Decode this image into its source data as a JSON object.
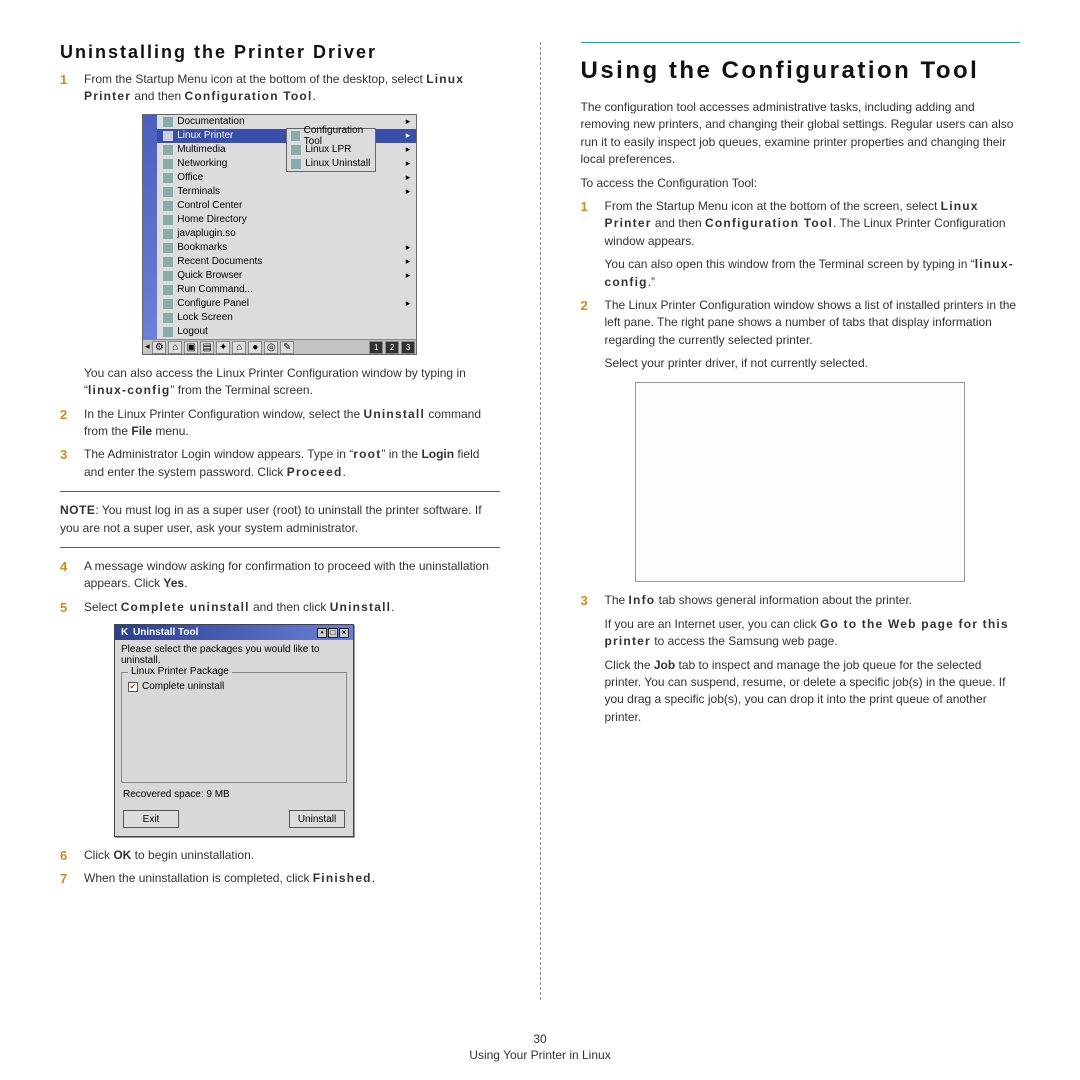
{
  "left": {
    "heading": "Uninstalling the Printer Driver",
    "step1_a": "From the Startup Menu icon at the bottom of the desktop, select ",
    "step1_b": "Linux Printer",
    "step1_c": " and then ",
    "step1_d": "Configuration Tool",
    "step1_e": ".",
    "kmenu": {
      "items": [
        "Documentation",
        "Linux Printer",
        "Multimedia",
        "Networking",
        "Office",
        "Terminals",
        "Control Center",
        "Home Directory",
        "javaplugin.so",
        "Bookmarks",
        "Recent Documents",
        "Quick Browser",
        "Run Command...",
        "Configure Panel",
        "Lock Screen",
        "Logout"
      ],
      "sub": [
        "Configuration Tool",
        "Linux LPR",
        "Linux Uninstall"
      ]
    },
    "after_menu_a": "You can also access the Linux Printer Configuration window by typing in “",
    "after_menu_b": "linux-config",
    "after_menu_c": "” from the Terminal screen.",
    "step2_a": "In the Linux Printer Configuration window, select the ",
    "step2_b": "Uninstall",
    "step2_c": " command from the ",
    "step2_d": "File",
    "step2_e": " menu.",
    "step3_a": "The Administrator Login window appears. Type in “",
    "step3_b": "root",
    "step3_c": "” in the ",
    "step3_d": "Login",
    "step3_e": " field and enter the system password. Click ",
    "step3_f": "Proceed",
    "step3_g": ".",
    "note_label": "NOTE",
    "note_text": ": You must log in as a super user (root) to uninstall the printer software. If you are not a super user, ask your system administrator.",
    "step4_a": "A message window asking for confirmation to proceed with the uninstallation appears. Click ",
    "step4_b": "Yes",
    "step4_c": ".",
    "step5_a": "Select ",
    "step5_b": "Complete uninstall",
    "step5_c": " and then click ",
    "step5_d": "Uninstall",
    "step5_e": ".",
    "uninstall_win": {
      "title": "Uninstall Tool",
      "prompt": "Please select the packages you would like to uninstall.",
      "group": "Linux Printer Package",
      "check": "Complete uninstall",
      "recovered": "Recovered space:  9 MB",
      "btn_exit": "Exit",
      "btn_uninstall": "Uninstall"
    },
    "step6_a": "Click ",
    "step6_b": "OK",
    "step6_c": " to begin uninstallation.",
    "step7_a": "When the uninstallation is completed, click ",
    "step7_b": "Finished",
    "step7_c": "."
  },
  "right": {
    "heading": "Using the Configuration Tool",
    "intro": "The configuration tool accesses administrative tasks, including adding and removing new printers, and changing their global settings. Regular users can also run it to easily inspect job queues, examine printer properties and changing their local preferences.",
    "access": "To access the Configuration Tool:",
    "s1_a": "From the Startup Menu icon at the bottom of the screen, select ",
    "s1_b": "Linux Printer",
    "s1_c": " and then ",
    "s1_d": "Configuration Tool",
    "s1_e": ". The Linux Printer Configuration window appears.",
    "s1_f": "You can also open this window from the Terminal screen by typing in “",
    "s1_g": "linux-config",
    "s1_h": ".”",
    "s2_a": "The Linux Printer Configuration window shows a list of installed printers in the left pane. The right pane shows a number of tabs that display information regarding the currently selected printer.",
    "s2_b": "Select your printer driver, if not currently selected.",
    "s3_a": "The ",
    "s3_b": "Info",
    "s3_c": " tab shows general information about the printer.",
    "s3_d": "If you are an Internet user, you can click ",
    "s3_e": "Go to the Web page for this printer",
    "s3_f": " to access the Samsung web page.",
    "s3_g": "Click the ",
    "s3_h": "Job",
    "s3_i": " tab to inspect and manage the job queue for the selected printer. You can suspend, resume, or delete a specific job(s) in the queue. If you drag a specific job(s), you can drop it into the print queue of another printer."
  },
  "footer": {
    "page": "30",
    "title": "Using Your Printer in Linux"
  }
}
